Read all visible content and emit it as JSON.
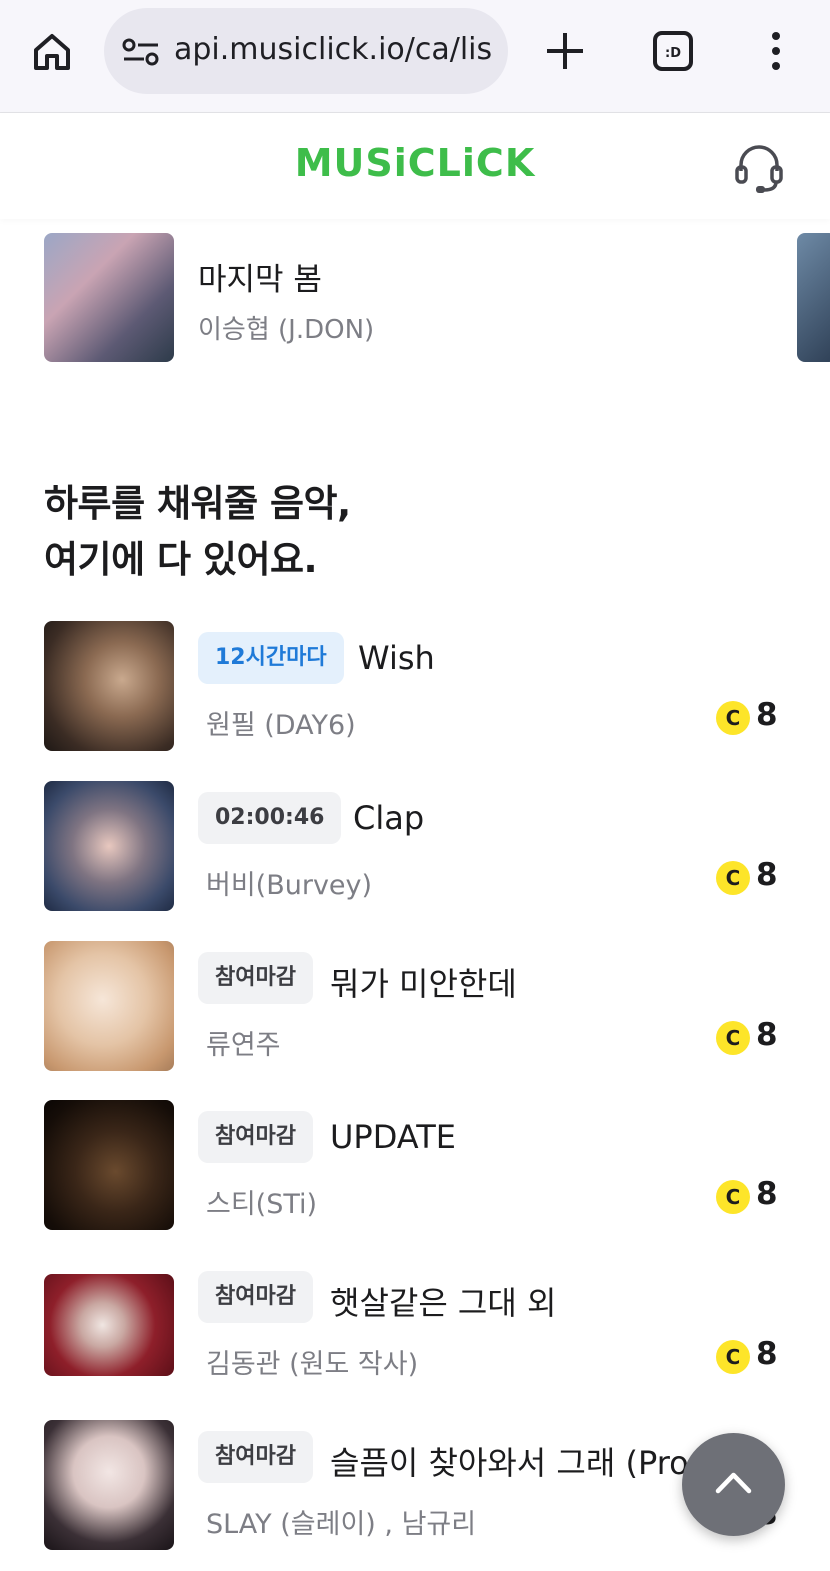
{
  "browser": {
    "url": "api.musiclick.io/ca/lis"
  },
  "header": {
    "logo": "MUSiCLiCK"
  },
  "featured": {
    "title": "마지막 봄",
    "artist": "이승협 (J.DON)"
  },
  "section": {
    "title_line1": "하루를 채워줄 음악,",
    "title_line2": "여기에 다 있어요."
  },
  "songs": [
    {
      "badge": "12시간마다",
      "title": "Wish",
      "artist": "원필 (DAY6)",
      "coin": "C",
      "price": "8"
    },
    {
      "badge": "02:00:46",
      "title": "Clap",
      "artist": "버비(Burvey)",
      "coin": "C",
      "price": "8"
    },
    {
      "badge": "참여마감",
      "title": "뭐가 미안한데",
      "artist": "류연주",
      "coin": "C",
      "price": "8"
    },
    {
      "badge": "참여마감",
      "title": "UPDATE",
      "artist": "스티(STi)",
      "coin": "C",
      "price": "8"
    },
    {
      "badge": "참여마감",
      "title": "햇살같은 그대 외",
      "artist": "김동관 (원도 작사)",
      "coin": "C",
      "price": "8"
    },
    {
      "badge": "참여마감",
      "title": "슬픔이 찾아와서 그래 (Pro",
      "artist": "SLAY (슬레이) , 남규리",
      "coin": "C",
      "price": "8"
    }
  ],
  "colors": {
    "brand": "#3ebd4a",
    "badge_blue_text": "#1f7ad8",
    "coin": "#fde529"
  },
  "icons": [
    "home-icon",
    "site-settings-icon",
    "new-tab-icon",
    "tab-switcher-icon",
    "more-menu-icon",
    "headset-icon",
    "chevron-up-icon"
  ]
}
